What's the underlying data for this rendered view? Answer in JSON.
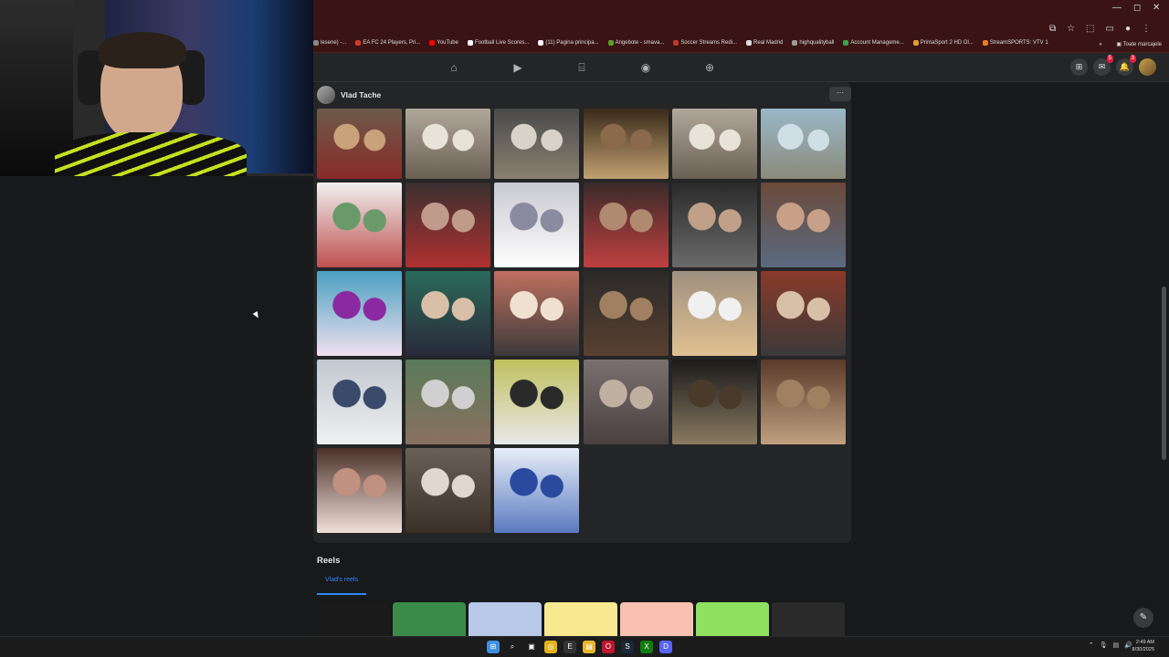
{
  "browser": {
    "bookmarks": [
      {
        "label": "lesene) -...",
        "color": "#888888"
      },
      {
        "label": "EA FC 24 Players, Pri...",
        "color": "#d03a2a"
      },
      {
        "label": "YouTube",
        "color": "#ff0000"
      },
      {
        "label": "Football Live Scores...",
        "color": "#ffffff"
      },
      {
        "label": "(11) Pagina principa...",
        "color": "#ffffff"
      },
      {
        "label": "Angebote - smava...",
        "color": "#5aa02a"
      },
      {
        "label": "Soccer Streams Redi...",
        "color": "#c0392b"
      },
      {
        "label": "Real Madrid",
        "color": "#dddddd"
      },
      {
        "label": "highqualityball",
        "color": "#999999"
      },
      {
        "label": "Account Manageme...",
        "color": "#3fa34d"
      },
      {
        "label": "PrimaSport 2 HD Ol...",
        "color": "#e0a030"
      },
      {
        "label": "StreamSPORTS: VTV 1",
        "color": "#e67e22"
      }
    ],
    "all_bookmarks": "Toate marcajele",
    "more_chevron": "»"
  },
  "facebook": {
    "nav_icons": [
      "home-icon",
      "video-icon",
      "marketplace-icon",
      "groups-icon",
      "gaming-icon"
    ],
    "right_nav": {
      "messenger_badge": "5",
      "notifications_badge": "3"
    },
    "profile_name": "Vlad Tache",
    "more_label": "···",
    "photos": [
      {
        "colors": [
          "#6b5b4a",
          "#c9a27a",
          "#8a2a2a"
        ]
      },
      {
        "colors": [
          "#b0a89a",
          "#e8e2d8",
          "#6a6054"
        ]
      },
      {
        "colors": [
          "#4a4a4a",
          "#d8d2c8",
          "#8a8070"
        ]
      },
      {
        "colors": [
          "#3a2a1a",
          "#8a6a4a",
          "#c0a070"
        ]
      },
      {
        "colors": [
          "#b0a89a",
          "#e8e2d8",
          "#6a6054"
        ]
      },
      {
        "colors": [
          "#9ab8c8",
          "#d0dfe6",
          "#8a8a7a"
        ]
      },
      {
        "colors": [
          "#f0f0f0",
          "#6a9a6a",
          "#c05050"
        ]
      },
      {
        "colors": [
          "#3a3030",
          "#c09a8a",
          "#b03030"
        ]
      },
      {
        "colors": [
          "#c8c8d0",
          "#8a8aa0",
          "#ffffff"
        ]
      },
      {
        "colors": [
          "#3a2a2a",
          "#b08a70",
          "#c04040"
        ]
      },
      {
        "colors": [
          "#2a2a2a",
          "#c0a088",
          "#6a6a6a"
        ]
      },
      {
        "colors": [
          "#6a4a3a",
          "#c8a088",
          "#5a6a80"
        ]
      },
      {
        "colors": [
          "#4aa0c0",
          "#8a2aa0",
          "#f0e0f0"
        ]
      },
      {
        "colors": [
          "#2a6a5a",
          "#d8c0a8",
          "#2a2a3a"
        ]
      },
      {
        "colors": [
          "#c07060",
          "#f0e0d0",
          "#3a3a3a"
        ]
      },
      {
        "colors": [
          "#2a2a2a",
          "#a08060",
          "#5a4030"
        ]
      },
      {
        "colors": [
          "#a09080",
          "#f0f0f0",
          "#e0c090"
        ]
      },
      {
        "colors": [
          "#8a3a2a",
          "#d8c0a8",
          "#3a3a3a"
        ]
      },
      {
        "colors": [
          "#c0c8d0",
          "#3a4a6a",
          "#f0f0f0"
        ]
      },
      {
        "colors": [
          "#5a7a5a",
          "#d0d0d0",
          "#8a7060"
        ]
      },
      {
        "colors": [
          "#c0c060",
          "#2a2a2a",
          "#e8e8e8"
        ]
      },
      {
        "colors": [
          "#7a7070",
          "#c0b0a0",
          "#4a4040"
        ]
      },
      {
        "colors": [
          "#1a1a1a",
          "#4a3a2a",
          "#8a7a60"
        ]
      },
      {
        "colors": [
          "#5a3a2a",
          "#a08060",
          "#c0a080"
        ]
      },
      {
        "colors": [
          "#4a3028",
          "#c09080",
          "#f0e0d8"
        ]
      },
      {
        "colors": [
          "#6a6058",
          "#e0d8d0",
          "#3a3028"
        ]
      },
      {
        "colors": [
          "#e8eef8",
          "#2a4aa0",
          "#5a7ac0"
        ]
      }
    ],
    "reels_title": "Reels",
    "reels_tab": "Vlad's reels",
    "reels": [
      {
        "color": "#1a1a1a"
      },
      {
        "color": "#3a8a4a"
      },
      {
        "color": "#b8c8e8"
      },
      {
        "color": "#f8e890"
      },
      {
        "color": "#f8c0b0"
      },
      {
        "color": "#90e060"
      },
      {
        "color": "#2a2a2a"
      }
    ]
  },
  "taskbar": {
    "icons": [
      "windows-start-icon",
      "search-icon",
      "task-view-icon",
      "chrome-icon",
      "epic-games-icon",
      "file-explorer-icon",
      "opera-gx-icon",
      "steam-icon",
      "xbox-icon",
      "discord-icon"
    ],
    "clock_time": "2:49 AM",
    "clock_date": "8/30/2025"
  }
}
